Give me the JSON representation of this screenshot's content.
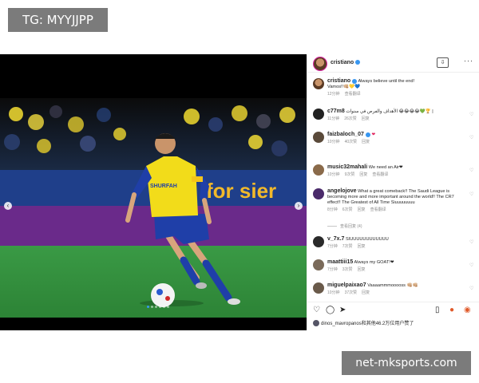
{
  "watermarks": {
    "top": "TG: MYYJJPP",
    "bottom": "net-mksports.com"
  },
  "post": {
    "author": "cristiano",
    "caption_line1": "Always believe until the end!",
    "caption_line2": "Vamos!!👊🏼💛💙",
    "caption_time": "12分钟",
    "caption_translate": "查看翻译",
    "jersey_sponsor": "SHURFAH",
    "stadium_banner": "for sier",
    "save_icon": "save-post-icon",
    "more_icon": "more-options-icon"
  },
  "comments": [
    {
      "user": "c77m8",
      "text": "الأهداف والفرص في سنوات 😂😂😂😂💚🏆 |",
      "time": "11分钟",
      "likes": "26次赞",
      "reply": "回复"
    },
    {
      "user": "faizbaloch_07",
      "text": "❤",
      "time": "10分钟",
      "likes": "40次赞",
      "reply": "回复"
    },
    {
      "user": "music32mahali",
      "text": "We need an Air❤",
      "time": "10分钟",
      "likes": "9次赞",
      "reply": "回复",
      "translate": "查看翻译"
    },
    {
      "user": "angelojove",
      "text": "What a great comeback!! The Saudi League is becoming more and more important around the world!! The CR7 effect!! The Greatest of All Time Siuuuuuuuu",
      "time": "8分钟",
      "likes": "6次赞",
      "reply": "回复",
      "translate": "查看翻译"
    },
    {
      "user": "v_7x.7",
      "text": "SIUUUUUUUUUUUU",
      "time": "7分钟",
      "likes": "7次赞",
      "reply": "回复"
    },
    {
      "user": "maattiii15",
      "text": "Always my GOAT!❤",
      "time": "7分钟",
      "likes": "3次赞",
      "reply": "回复"
    },
    {
      "user": "miguelpaixao7",
      "text": "Vaaaammmooooss 👊🏼👊🏼",
      "time": "10分钟",
      "likes": "37次赞",
      "reply": "回复"
    }
  ],
  "replies_label": "查看回复 (4)",
  "likes_line": "dinos_mavropanos和其他46.2万位用户赞了",
  "colors": {
    "accent": "#3897f0",
    "heart": "#e0245e",
    "jersey": "#f2dc1a",
    "shorts": "#1f3fa8",
    "pitch": "#2f8f3a"
  }
}
